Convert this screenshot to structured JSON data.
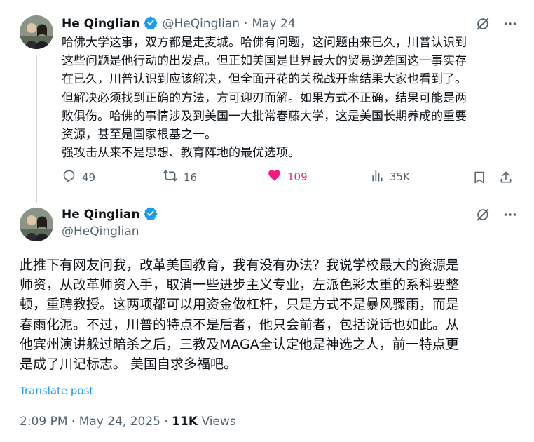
{
  "colors": {
    "accent": "#1d9bf0",
    "like": "#f91880",
    "muted": "#536471",
    "text": "#0f1419"
  },
  "reply_tweet": {
    "author_name": "He Qinglian",
    "handle": "@HeQinglian",
    "separator": "·",
    "date": "May 24",
    "body_lines": [
      "哈佛大学这事，双方都是走麦城。哈佛有问题，这问题由来已久，川普认识到",
      "这些问题是他行动的出发点。但正如美国是世界最大的贸易逆差国这一事实存",
      "在已久，川普认识到应该解决，但全面开花的关税战开盘结果大家也看到了。",
      "但解决必须找到正确的方法，方可迎刃而解。如果方式不正确，结果可能是两",
      "败俱伤。哈佛的事情涉及到美国一大批常春藤大学，这是美国长期养成的重要",
      "资源，甚至是国家根基之一。",
      "强攻击从来不是思想、教育阵地的最优选项。"
    ],
    "stats": {
      "replies": "49",
      "reposts": "16",
      "likes": "109",
      "views": "35K"
    },
    "icons": [
      "grok-icon",
      "more-icon",
      "reply-icon",
      "repost-icon",
      "heart-icon",
      "views-icon",
      "bookmark-icon",
      "share-icon",
      "verified-badge-icon"
    ]
  },
  "main_tweet": {
    "author_name": "He Qinglian",
    "handle": "@HeQinglian",
    "body_lines": [
      "此推下有网友问我，改革美国教育，我有没有办法？我说学校最大的资源是",
      "师资，从改革师资入手，取消一些进步主义专业，左派色彩太重的系科要整",
      "顿，重聘教授。这两项都可以用资金做杠杆，只是方式不是暴风骤雨，而是",
      "春雨化泥。不过，川普的特点不是后者，他只会前者，包括说话也如此。从",
      "他宾州演讲躲过暗杀之后，三教及MAGA全认定他是神选之人，前一特点更",
      "是成了川记标志。 美国自求多福吧。"
    ],
    "translate_label": "Translate post",
    "time": "2:09 PM",
    "separator": "·",
    "date": "May 24, 2025",
    "views_count": "11K",
    "views_label": "Views"
  }
}
